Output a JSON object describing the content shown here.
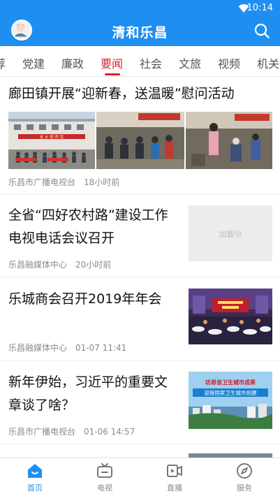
{
  "status_bar": {
    "time": "10:14"
  },
  "app_bar": {
    "title": "清和乐昌"
  },
  "tabs": [
    {
      "label": "荐"
    },
    {
      "label": "党建"
    },
    {
      "label": "廉政"
    },
    {
      "label": "要闻",
      "active": true
    },
    {
      "label": "社会"
    },
    {
      "label": "文旅"
    },
    {
      "label": "视频"
    },
    {
      "label": "机关"
    }
  ],
  "feed": [
    {
      "title": "廊田镇开展“迎新春，送温暖”慰问活动",
      "source": "乐昌市广播电视台",
      "time": "18小时前",
      "image_banner_text": "老 乡 颐 养 院"
    },
    {
      "title_line1": "全省“四好农村路”建设工作",
      "title_line2": "电视电话会议召开",
      "source": "乐昌融媒体中心",
      "time": "20小时前",
      "thumb_placeholder": "加载中"
    },
    {
      "title": "乐城商会召开2019年年会",
      "source": "乐昌融媒体中心",
      "time": "01-07 11:41"
    },
    {
      "title_line1": "新年伊始，习近平的重要文",
      "title_line2": "章谈了啥？",
      "source": "乐昌市广播电视台",
      "time": "01-06 14:57",
      "thumb_caption_line1": "坊恩省卫生城市成果",
      "thumb_caption_line2": "迎接国家卫生城市创建"
    }
  ],
  "bottom_nav": [
    {
      "label": "首页",
      "icon": "home-icon",
      "active": true
    },
    {
      "label": "电视",
      "icon": "tv-icon"
    },
    {
      "label": "直播",
      "icon": "live-icon"
    },
    {
      "label": "服务",
      "icon": "compass-icon"
    }
  ],
  "colors": {
    "brand": "#1e8ff0",
    "active_tab": "#d9232d",
    "meta": "#8a8a8a"
  }
}
